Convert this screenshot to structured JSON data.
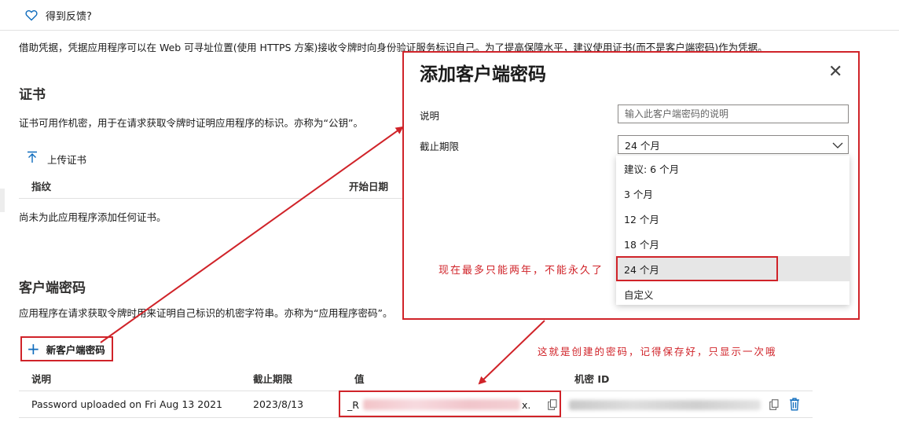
{
  "feedback": {
    "label": "得到反馈?"
  },
  "intro": "借助凭据，凭据应用程序可以在 Web 可寻址位置(使用 HTTPS 方案)接收令牌时向身份验证服务标识自己。为了提高保障水平，建议使用证书(而不是客户端密码)作为凭据。",
  "certificates": {
    "title": "证书",
    "description": "证书可用作机密，用于在请求获取令牌时证明应用程序的标识。亦称为“公钥”。",
    "upload_label": "上传证书",
    "columns": [
      "指纹",
      "开始日期"
    ],
    "empty_text": "尚未为此应用程序添加任何证书。"
  },
  "client_secrets": {
    "title": "客户端密码",
    "description": "应用程序在请求获取令牌时用来证明自己标识的机密字符串。亦称为“应用程序密码”。",
    "new_button": "新客户端密码",
    "columns": [
      "说明",
      "截止期限",
      "值",
      "机密 ID"
    ],
    "rows": [
      {
        "description": "Password uploaded on Fri Aug 13 2021",
        "expires": "2023/8/13",
        "value_prefix": "_R",
        "value_suffix": "x."
      }
    ]
  },
  "dialog": {
    "title": "添加客户端密码",
    "description_label": "说明",
    "description_placeholder": "输入此客户端密码的说明",
    "expires_label": "截止期限",
    "expires_value": "24 个月",
    "options": [
      "建议: 6 个月",
      "3 个月",
      "12 个月",
      "18 个月",
      "24 个月",
      "自定义"
    ],
    "selected_index": 4
  },
  "annotations": {
    "note_max": "现在最多只能两年，不能永久了",
    "note_value": "这就是创建的密码，记得保存好，只显示一次哦"
  },
  "colors": {
    "annotation_red": "#d02329",
    "accent_blue": "#0f6cbd"
  }
}
